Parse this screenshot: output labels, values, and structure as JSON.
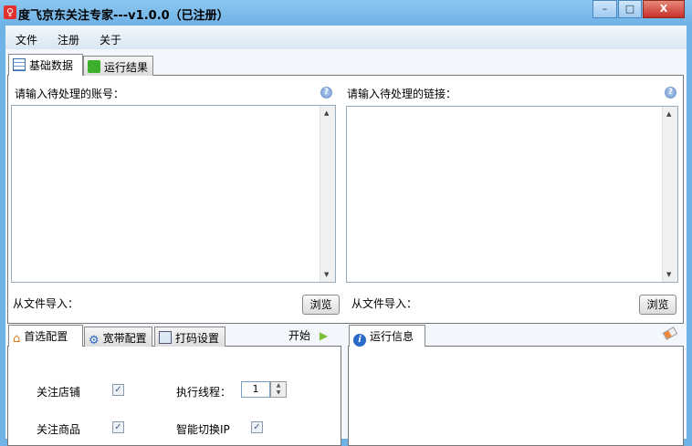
{
  "window": {
    "title": "度飞京东关注专家---v1.0.0（已注册）",
    "app_icon": "user-icon"
  },
  "menu": [
    "文件",
    "注册",
    "关于"
  ],
  "top_tabs": [
    {
      "label": "基础数据",
      "icon": "table-icon"
    },
    {
      "label": "运行结果",
      "icon": "save-icon"
    }
  ],
  "accounts": {
    "label": "请输入待处理的账号：",
    "value": "",
    "import_label": "从文件导入：",
    "browse": "浏览"
  },
  "links": {
    "label": "请输入待处理的链接：",
    "value": "",
    "import_label": "从文件导入：",
    "browse": "浏览"
  },
  "bottom_tabs": [
    {
      "label": "首选配置",
      "icon": "home-icon"
    },
    {
      "label": "宽带配置",
      "icon": "gear-icon"
    },
    {
      "label": "打码设置",
      "icon": "captcha-icon"
    }
  ],
  "start_label": "开始",
  "settings": {
    "follow_shop": {
      "label": "关注店铺",
      "checked": true
    },
    "follow_product": {
      "label": "关注商品",
      "checked": true
    },
    "threads": {
      "label": "执行线程：",
      "value": "1"
    },
    "smart_ip": {
      "label": "智能切换IP",
      "checked": true
    }
  },
  "log_tab": {
    "label": "运行信息",
    "icon": "info-icon"
  }
}
